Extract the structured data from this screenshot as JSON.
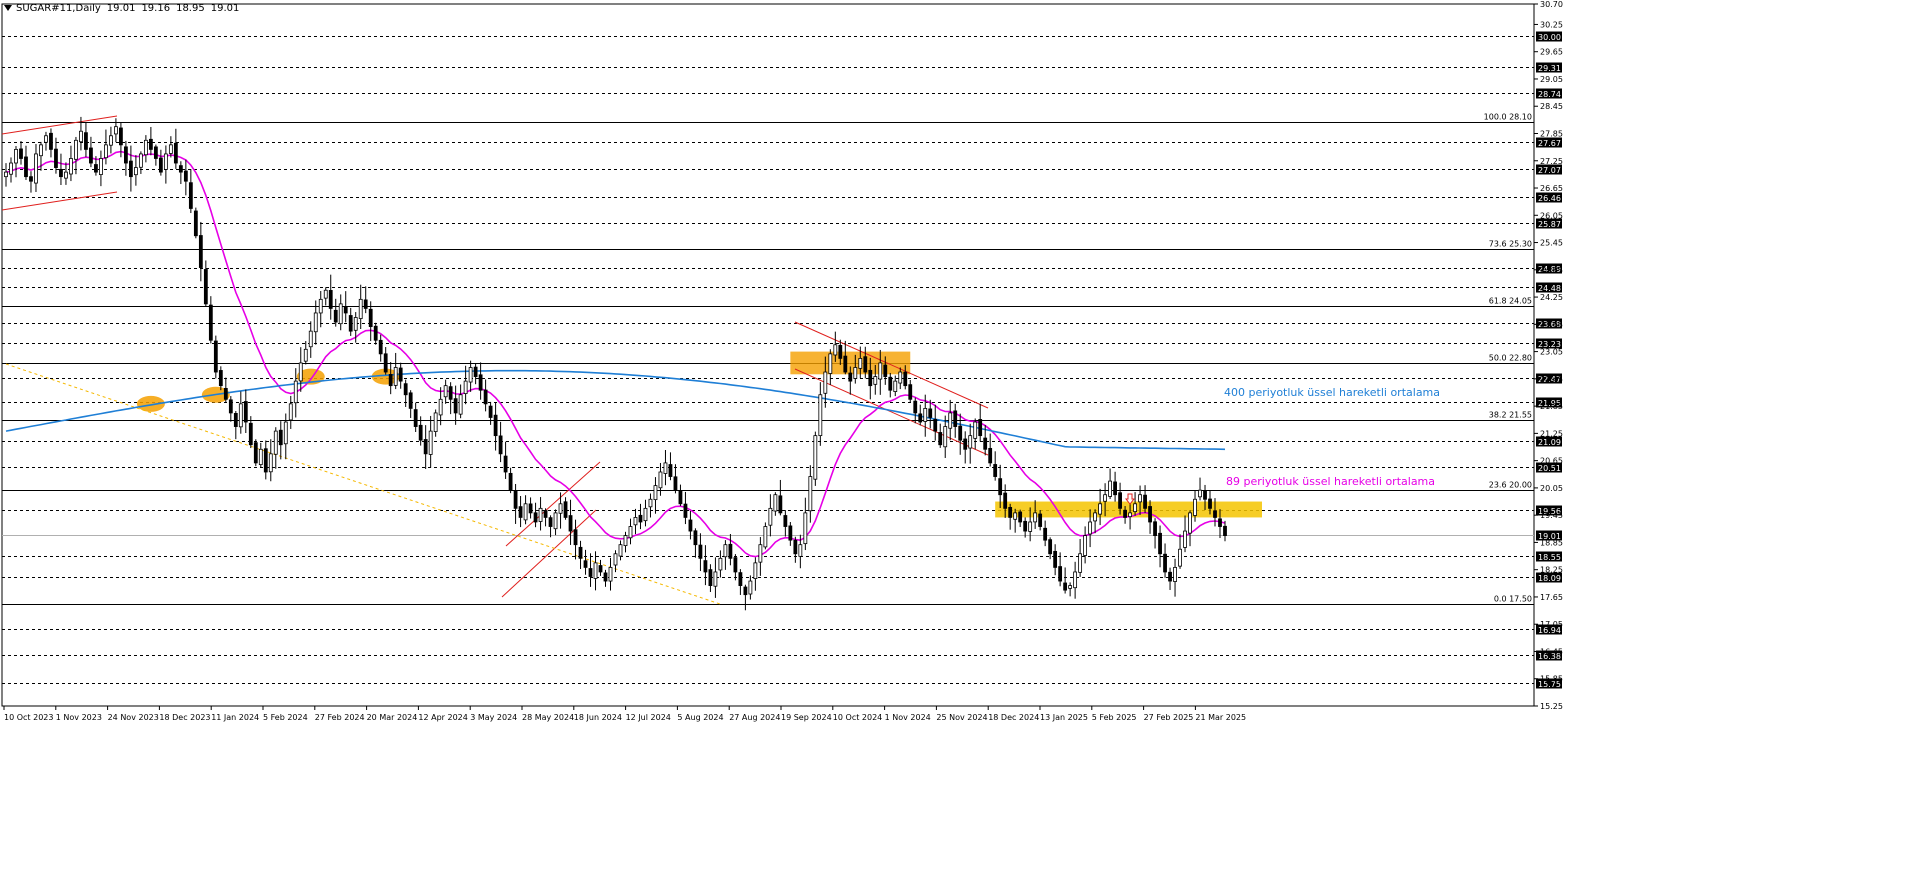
{
  "header": {
    "symbol": "SUGAR#11,Daily",
    "open": "19.01",
    "high": "19.16",
    "low": "18.95",
    "close": "19.01"
  },
  "chart_data": {
    "type": "candlestick",
    "symbol": "SUGAR#11",
    "timeframe": "Daily",
    "ylim": [
      15.25,
      30.7
    ],
    "x_labels": [
      "10 Oct 2023",
      "1 Nov 2023",
      "24 Nov 2023",
      "18 Dec 2023",
      "11 Jan 2024",
      "5 Feb 2024",
      "27 Feb 2024",
      "20 Mar 2024",
      "12 Apr 2024",
      "3 May 2024",
      "28 May 2024",
      "18 Jun 2024",
      "12 Jul 2024",
      "5 Aug 2024",
      "27 Aug 2024",
      "19 Sep 2024",
      "10 Oct 2024",
      "1 Nov 2024",
      "25 Nov 2024",
      "18 Dec 2024",
      "13 Jan 2025",
      "5 Feb 2025",
      "27 Feb 2025",
      "21 Mar 2025"
    ],
    "y_ticks": [
      "30.70",
      "30.25",
      "29.65",
      "29.05",
      "28.45",
      "27.85",
      "27.25",
      "26.65",
      "26.05",
      "25.45",
      "24.85",
      "24.25",
      "23.65",
      "23.05",
      "22.45",
      "21.85",
      "21.25",
      "20.65",
      "20.05",
      "19.45",
      "18.85",
      "18.25",
      "17.65",
      "17.05",
      "16.45",
      "15.85",
      "15.25"
    ],
    "price_levels": [
      "30.00",
      "29.31",
      "28.74",
      "27.67",
      "27.07",
      "26.46",
      "25.87",
      "24.89",
      "24.48",
      "23.68",
      "23.23",
      "22.47",
      "21.95",
      "21.09",
      "20.51",
      "19.56",
      "18.55",
      "18.09",
      "16.94",
      "16.38",
      "15.75"
    ],
    "current_price": "19.01",
    "fibonacci": [
      {
        "label": "100.0 28.10",
        "value": 28.1
      },
      {
        "label": "73.6 25.30",
        "value": 25.3
      },
      {
        "label": "61.8 24.05",
        "value": 24.05
      },
      {
        "label": "50.0 22.80",
        "value": 22.8
      },
      {
        "label": "38.2 21.55",
        "value": 21.55
      },
      {
        "label": "23.6 20.00",
        "value": 20.0
      },
      {
        "label": "0.0 17.50",
        "value": 17.5
      }
    ],
    "annotations": {
      "ema400": "400 periyotluk üssel hareketli ortalama",
      "ema89": "89 periyotluk üssel hareketli ortalama"
    },
    "candle_closes": [
      27.0,
      27.2,
      27.5,
      27.3,
      26.9,
      26.8,
      27.4,
      27.6,
      27.8,
      27.5,
      27.1,
      26.9,
      27.0,
      27.3,
      27.7,
      27.9,
      27.5,
      27.2,
      27.0,
      27.3,
      27.6,
      27.8,
      28.0,
      27.6,
      27.2,
      26.9,
      27.1,
      27.4,
      27.7,
      27.5,
      27.3,
      27.0,
      27.4,
      27.6,
      27.2,
      27.0,
      26.8,
      26.2,
      25.6,
      24.9,
      24.1,
      23.3,
      22.6,
      22.3,
      22.0,
      21.7,
      21.4,
      21.9,
      21.5,
      21.0,
      20.6,
      20.9,
      20.4,
      20.8,
      21.3,
      21.0,
      21.5,
      21.9,
      22.4,
      22.8,
      23.1,
      23.5,
      23.9,
      24.2,
      24.4,
      24.0,
      23.7,
      24.1,
      23.9,
      23.5,
      23.8,
      24.2,
      24.0,
      23.6,
      23.3,
      23.0,
      22.6,
      22.3,
      22.7,
      22.4,
      22.1,
      21.8,
      21.4,
      21.1,
      20.8,
      21.3,
      21.7,
      22.0,
      22.3,
      22.0,
      21.7,
      22.1,
      22.4,
      22.7,
      22.5,
      22.2,
      21.9,
      21.6,
      21.2,
      20.8,
      20.4,
      20.0,
      19.6,
      19.4,
      19.7,
      19.5,
      19.3,
      19.6,
      19.4,
      19.2,
      19.5,
      19.7,
      19.4,
      19.1,
      18.8,
      18.5,
      18.3,
      18.1,
      18.4,
      18.2,
      18.0,
      18.3,
      18.6,
      18.8,
      19.0,
      19.2,
      19.4,
      19.3,
      19.6,
      19.8,
      20.1,
      20.4,
      20.6,
      20.3,
      20.0,
      19.7,
      19.4,
      19.1,
      18.8,
      18.5,
      18.2,
      17.9,
      18.2,
      18.5,
      18.8,
      18.5,
      18.2,
      17.9,
      17.7,
      18.0,
      18.4,
      18.8,
      19.2,
      19.6,
      19.9,
      19.5,
      19.2,
      18.9,
      18.6,
      18.8,
      19.5,
      20.3,
      21.2,
      22.1,
      22.6,
      23.0,
      23.2,
      22.9,
      22.6,
      22.4,
      22.7,
      22.9,
      22.6,
      22.3,
      22.5,
      22.8,
      22.5,
      22.2,
      22.4,
      22.6,
      22.3,
      22.0,
      21.7,
      21.5,
      21.8,
      21.6,
      21.3,
      21.0,
      21.4,
      21.7,
      21.4,
      21.1,
      20.9,
      21.2,
      21.5,
      21.2,
      20.9,
      20.6,
      20.3,
      19.9,
      19.6,
      19.4,
      19.5,
      19.3,
      19.1,
      19.3,
      19.5,
      19.2,
      18.9,
      18.6,
      18.3,
      18.0,
      17.8,
      17.9,
      18.2,
      18.6,
      19.0,
      19.3,
      19.5,
      19.7,
      19.9,
      20.2,
      19.9,
      19.6,
      19.4,
      19.5,
      19.7,
      19.9,
      19.6,
      19.3,
      19.0,
      18.6,
      18.2,
      18.0,
      18.3,
      18.7,
      19.1,
      19.5,
      19.8,
      20.0,
      19.8,
      19.6,
      19.4,
      19.2,
      19.0
    ]
  }
}
